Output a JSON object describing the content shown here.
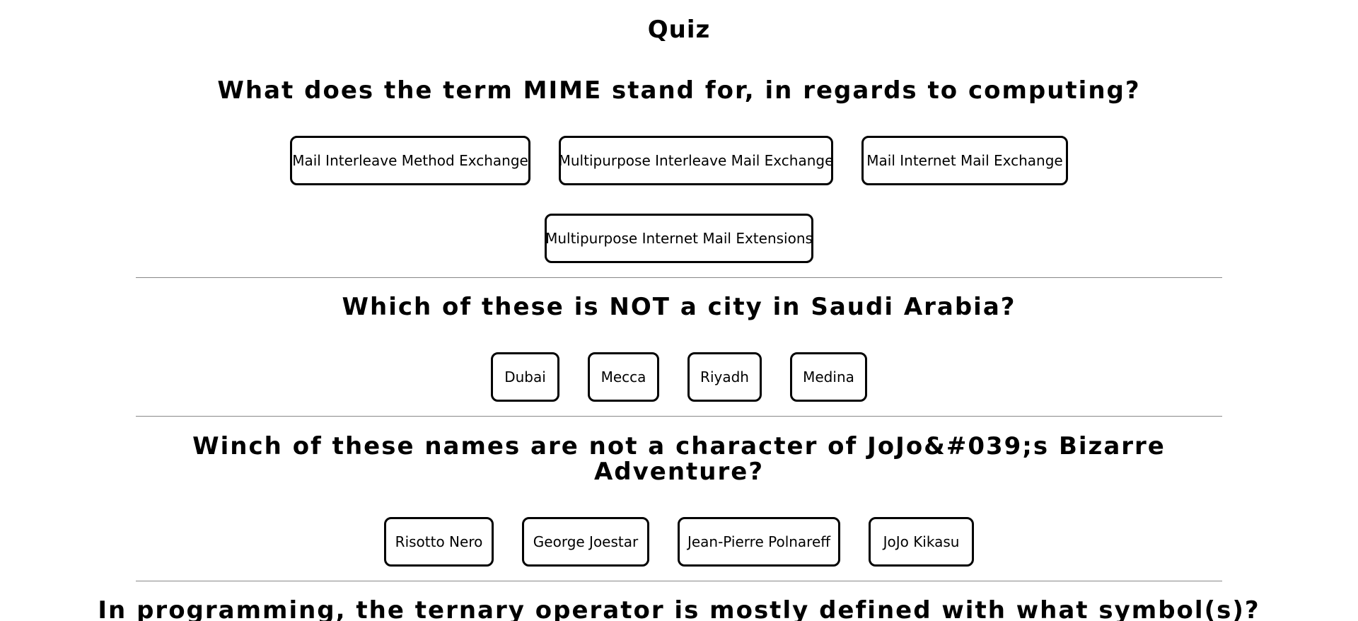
{
  "quiz_title": "Quiz",
  "questions": [
    {
      "text": "What does the term MIME stand for, in regards to computing?",
      "answers": [
        "Mail Interleave Method Exchange",
        "Multipurpose Interleave Mail Exchange",
        "Mail Internet Mail Exchange",
        "Multipurpose Internet Mail Extensions"
      ]
    },
    {
      "text": "Which of these is NOT a city in Saudi Arabia?",
      "answers": [
        "Dubai",
        "Mecca",
        "Riyadh",
        "Medina"
      ]
    },
    {
      "text": "Winch of these names are not a character of JoJo&#039;s Bizarre Adventure?",
      "answers": [
        "Risotto Nero",
        "George Joestar",
        "Jean-Pierre Polnareff",
        "JoJo Kikasu"
      ]
    },
    {
      "text": "In programming, the ternary operator is mostly defined with what symbol(s)?"
    }
  ]
}
